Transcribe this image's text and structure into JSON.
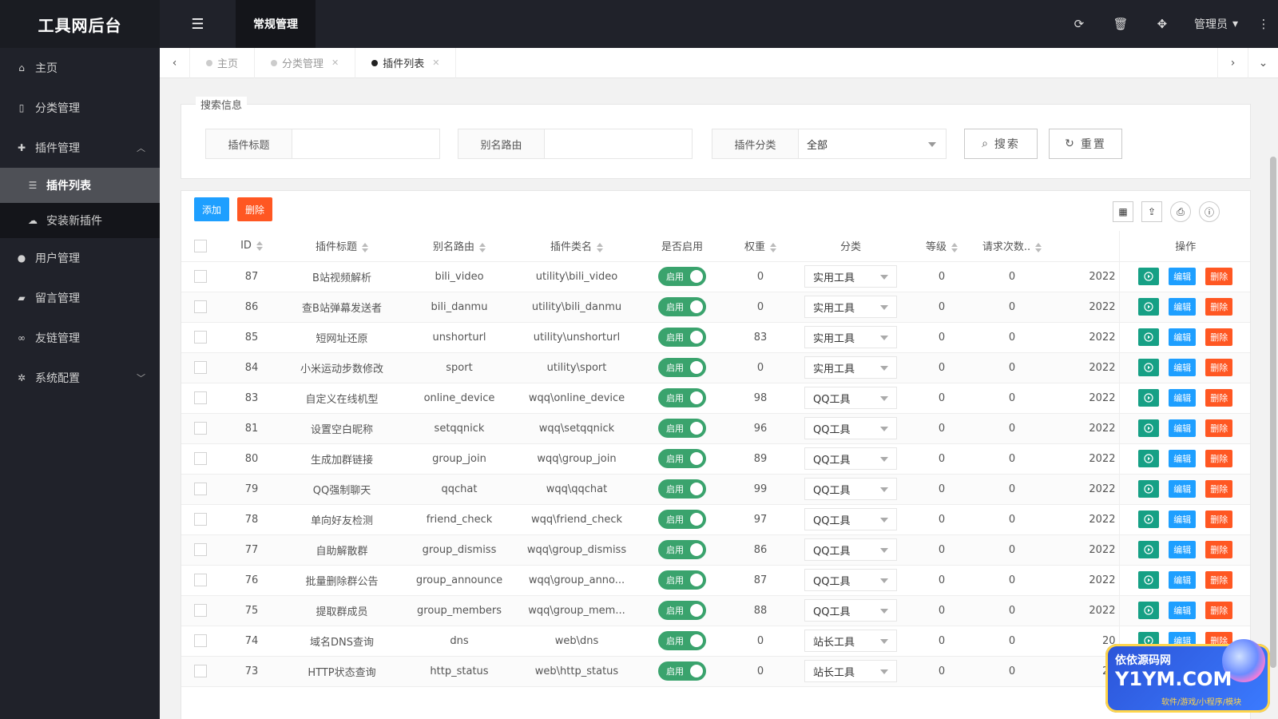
{
  "app": {
    "logo": "工具网后台"
  },
  "topbar": {
    "active_tab": "常规管理",
    "user": "管理员"
  },
  "sidebar": {
    "items": [
      {
        "label": "主页",
        "icon": "home-icon"
      },
      {
        "label": "分类管理",
        "icon": "bookmark-icon"
      },
      {
        "label": "插件管理",
        "icon": "puzzle-icon"
      },
      {
        "label": "用户管理",
        "icon": "user-icon"
      },
      {
        "label": "留言管理",
        "icon": "comments-icon"
      },
      {
        "label": "友链管理",
        "icon": "link-icon"
      },
      {
        "label": "系统配置",
        "icon": "cogs-icon"
      }
    ],
    "sub_items": [
      {
        "label": "插件列表",
        "icon": "list-icon"
      },
      {
        "label": "安装新插件",
        "icon": "cloud-upload-icon"
      }
    ]
  },
  "tabs": [
    {
      "label": "主页"
    },
    {
      "label": "分类管理"
    },
    {
      "label": "插件列表"
    }
  ],
  "search": {
    "legend": "搜索信息",
    "title_label": "插件标题",
    "title_value": "",
    "alias_label": "别名路由",
    "alias_value": "",
    "category_label": "插件分类",
    "category_value": "全部",
    "search_btn": "搜索",
    "reset_btn": "重置"
  },
  "toolbar": {
    "add": "添加",
    "delete": "删除"
  },
  "table": {
    "headers": [
      "ID",
      "插件标题",
      "别名路由",
      "插件类名",
      "是否启用",
      "权重",
      "分类",
      "等级",
      "请求次数..",
      "",
      "操作"
    ],
    "switch_label": "启用",
    "edit_label": "编辑",
    "del_label": "删除",
    "rows": [
      {
        "id": "87",
        "title": "B站视频解析",
        "alias": "bili_video",
        "cls": "utility\\bili_video",
        "weight": "0",
        "cat": "实用工具",
        "level": "0",
        "req": "0",
        "date": "2022"
      },
      {
        "id": "86",
        "title": "查B站弹幕发送者",
        "alias": "bili_danmu",
        "cls": "utility\\bili_danmu",
        "weight": "0",
        "cat": "实用工具",
        "level": "0",
        "req": "0",
        "date": "2022"
      },
      {
        "id": "85",
        "title": "短网址还原",
        "alias": "unshorturl",
        "cls": "utility\\unshorturl",
        "weight": "83",
        "cat": "实用工具",
        "level": "0",
        "req": "0",
        "date": "2022"
      },
      {
        "id": "84",
        "title": "小米运动步数修改",
        "alias": "sport",
        "cls": "utility\\sport",
        "weight": "0",
        "cat": "实用工具",
        "level": "0",
        "req": "0",
        "date": "2022"
      },
      {
        "id": "83",
        "title": "自定义在线机型",
        "alias": "online_device",
        "cls": "wqq\\online_device",
        "weight": "98",
        "cat": "QQ工具",
        "level": "0",
        "req": "0",
        "date": "2022"
      },
      {
        "id": "81",
        "title": "设置空白昵称",
        "alias": "setqqnick",
        "cls": "wqq\\setqqnick",
        "weight": "96",
        "cat": "QQ工具",
        "level": "0",
        "req": "0",
        "date": "2022"
      },
      {
        "id": "80",
        "title": "生成加群链接",
        "alias": "group_join",
        "cls": "wqq\\group_join",
        "weight": "89",
        "cat": "QQ工具",
        "level": "0",
        "req": "0",
        "date": "2022"
      },
      {
        "id": "79",
        "title": "QQ强制聊天",
        "alias": "qqchat",
        "cls": "wqq\\qqchat",
        "weight": "99",
        "cat": "QQ工具",
        "level": "0",
        "req": "0",
        "date": "2022"
      },
      {
        "id": "78",
        "title": "单向好友检测",
        "alias": "friend_check",
        "cls": "wqq\\friend_check",
        "weight": "97",
        "cat": "QQ工具",
        "level": "0",
        "req": "0",
        "date": "2022"
      },
      {
        "id": "77",
        "title": "自助解散群",
        "alias": "group_dismiss",
        "cls": "wqq\\group_dismiss",
        "weight": "86",
        "cat": "QQ工具",
        "level": "0",
        "req": "0",
        "date": "2022"
      },
      {
        "id": "76",
        "title": "批量删除群公告",
        "alias": "group_announce",
        "cls": "wqq\\group_anno...",
        "weight": "87",
        "cat": "QQ工具",
        "level": "0",
        "req": "0",
        "date": "2022"
      },
      {
        "id": "75",
        "title": "提取群成员",
        "alias": "group_members",
        "cls": "wqq\\group_mem...",
        "weight": "88",
        "cat": "QQ工具",
        "level": "0",
        "req": "0",
        "date": "2022"
      },
      {
        "id": "74",
        "title": "域名DNS查询",
        "alias": "dns",
        "cls": "web\\dns",
        "weight": "0",
        "cat": "站长工具",
        "level": "0",
        "req": "0",
        "date": "20"
      },
      {
        "id": "73",
        "title": "HTTP状态查询",
        "alias": "http_status",
        "cls": "web\\http_status",
        "weight": "0",
        "cat": "站长工具",
        "level": "0",
        "req": "0",
        "date": "20"
      }
    ]
  },
  "watermark": {
    "line1": "依依源码网",
    "line2": "Y1YM.COM",
    "line3": "软件/游戏/小程序/模块"
  }
}
